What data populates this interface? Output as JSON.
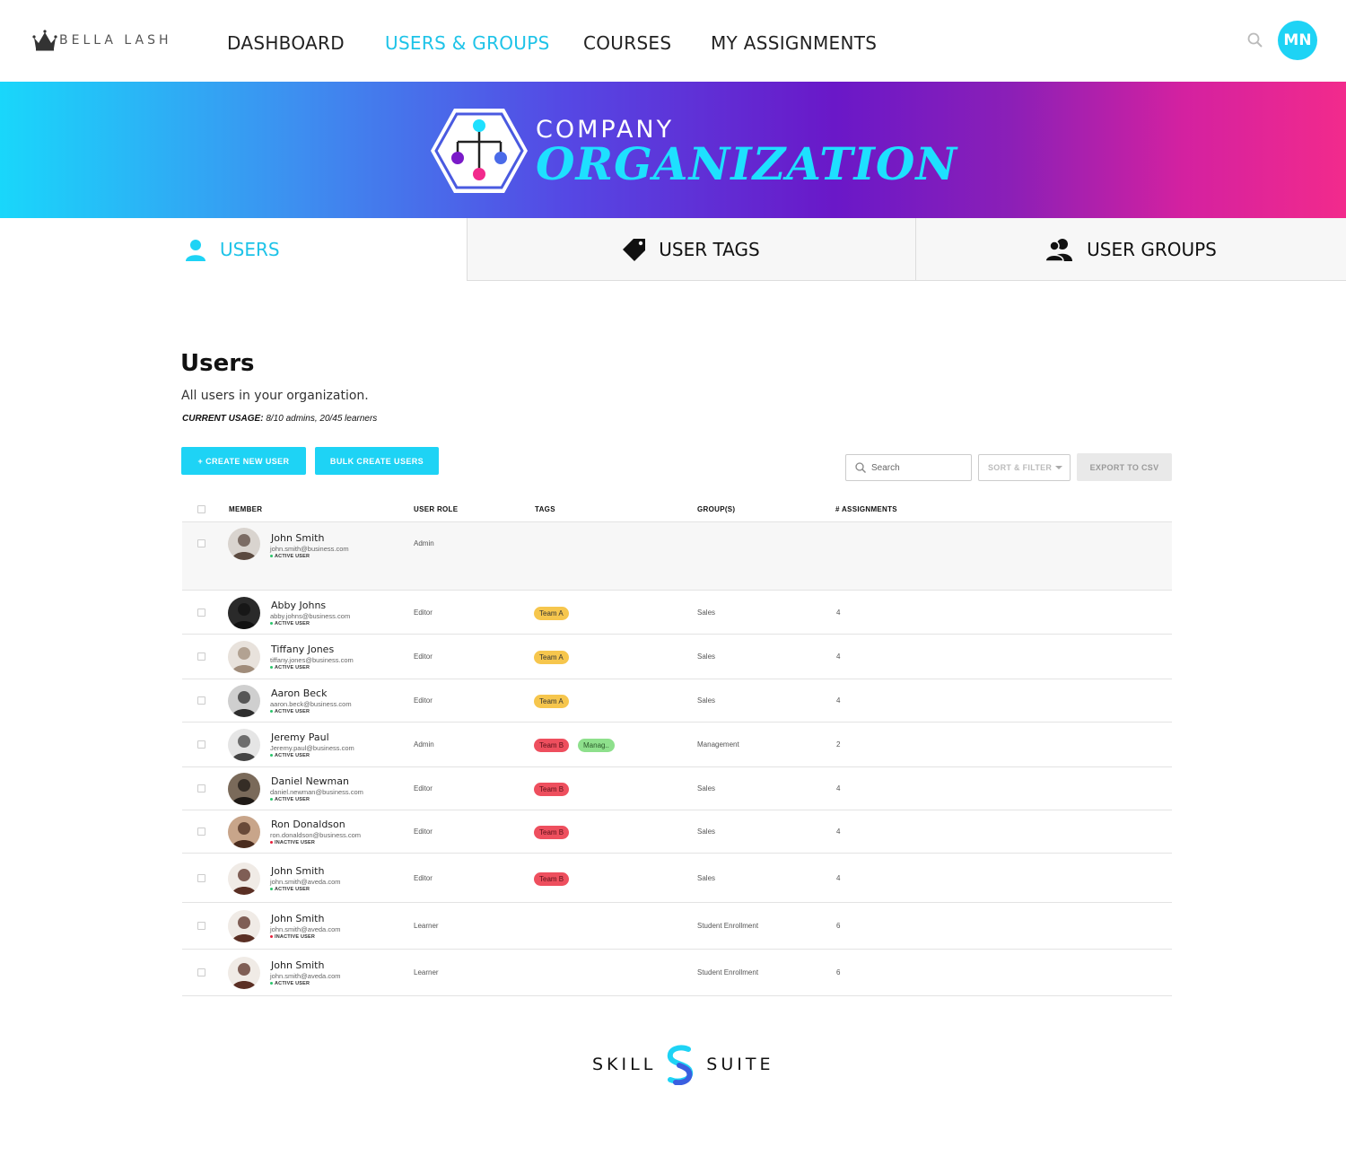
{
  "brand": {
    "name": "BELLA LASH",
    "icon": "crown-icon"
  },
  "nav": {
    "items": [
      {
        "label": "DASHBOARD",
        "active": false
      },
      {
        "label": "USERS & GROUPS",
        "active": true
      },
      {
        "label": "COURSES",
        "active": false
      },
      {
        "label": "MY ASSIGNMENTS",
        "active": false
      }
    ],
    "search_icon": "search-icon",
    "user_initials": "MN"
  },
  "banner": {
    "line1": "COMPANY",
    "line2": "ORGANIZATION",
    "icon": "org-chart-icon"
  },
  "tabs": [
    {
      "label": "USERS",
      "icon": "user-icon",
      "active": true
    },
    {
      "label": "USER TAGS",
      "icon": "tag-icon",
      "active": false
    },
    {
      "label": "USER GROUPS",
      "icon": "users-icon",
      "active": false
    }
  ],
  "section": {
    "title": "Users",
    "subtitle": "All users in your organization.",
    "usage_label": "CURRENT USAGE:",
    "usage_value": "8/10 admins, 20/45 learners"
  },
  "toolbar": {
    "create_label": "+ CREATE NEW USER",
    "bulk_label": "BULK CREATE USERS",
    "search_placeholder": "Search",
    "sort_label": "SORT & FILTER",
    "export_label": "EXPORT TO CSV"
  },
  "table": {
    "columns": [
      "MEMBER",
      "USER ROLE",
      "TAGS",
      "GROUP(S)",
      "# ASSIGNMENTS"
    ],
    "rows": [
      {
        "name": "John Smith",
        "email": "john.smith@business.com",
        "status": "ACTIVE USER",
        "role": "Admin",
        "tags": [],
        "group": "",
        "assignments": ""
      },
      {
        "name": "Abby Johns",
        "email": "abby.johns@business.com",
        "status": "ACTIVE USER",
        "role": "Editor",
        "tags": [
          "Team A"
        ],
        "group": "Sales",
        "assignments": "4"
      },
      {
        "name": "Tiffany Jones",
        "email": "tiffany.jones@business.com",
        "status": "ACTIVE USER",
        "role": "Editor",
        "tags": [
          "Team A"
        ],
        "group": "Sales",
        "assignments": "4"
      },
      {
        "name": "Aaron Beck",
        "email": "aaron.beck@business.com",
        "status": "ACTIVE USER",
        "role": "Editor",
        "tags": [
          "Team A"
        ],
        "group": "Sales",
        "assignments": "4"
      },
      {
        "name": "Jeremy Paul",
        "email": "Jeremy.paul@business.com",
        "status": "ACTIVE USER",
        "role": "Admin",
        "tags": [
          "Team B",
          "Manag.."
        ],
        "group": "Management",
        "assignments": "2"
      },
      {
        "name": "Daniel Newman",
        "email": "daniel.newman@business.com",
        "status": "ACTIVE USER",
        "role": "Editor",
        "tags": [
          "Team B"
        ],
        "group": "Sales",
        "assignments": "4"
      },
      {
        "name": "Ron Donaldson",
        "email": "ron.donaldson@business.com",
        "status": "INACTIVE USER",
        "role": "Editor",
        "tags": [
          "Team B"
        ],
        "group": "Sales",
        "assignments": "4"
      },
      {
        "name": "John Smith",
        "email": "john.smith@aveda.com",
        "status": "ACTIVE USER",
        "role": "Editor",
        "tags": [
          "Team B"
        ],
        "group": "Sales",
        "assignments": "4"
      },
      {
        "name": "John Smith",
        "email": "john.smith@aveda.com",
        "status": "INACTIVE USER",
        "role": "Learner",
        "tags": [],
        "group": "Student Enrollment",
        "assignments": "6"
      },
      {
        "name": "John Smith",
        "email": "john.smith@aveda.com",
        "status": "ACTIVE USER",
        "role": "Learner",
        "tags": [],
        "group": "Student Enrollment",
        "assignments": "6"
      }
    ]
  },
  "colors": {
    "accent": "#1ed3f5",
    "active_dot": "#2bc46b",
    "inactive_dot": "#e8203c",
    "tag_team_a": "#f6c64d",
    "tag_team_b": "#ee4f5e",
    "tag_management": "#8ee08c"
  },
  "footer": {
    "left": "SKILL",
    "right": "SUITE",
    "icon": "skillsuite-s-logo"
  }
}
